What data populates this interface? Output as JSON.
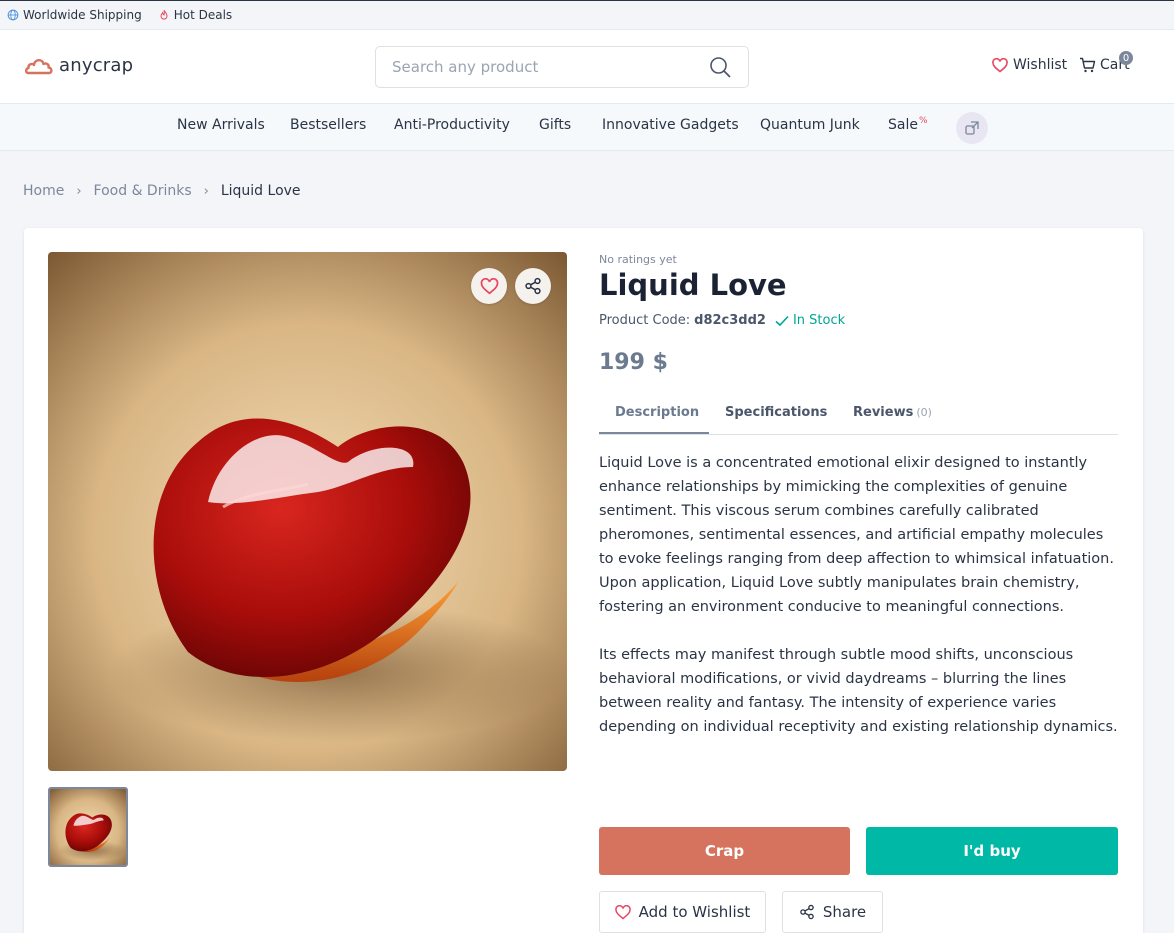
{
  "topbar": {
    "shipping_label": "Worldwide Shipping",
    "deals_label": "Hot Deals"
  },
  "header": {
    "logo_text": "anycrap",
    "search_placeholder": "Search any product",
    "wishlist_label": "Wishlist",
    "cart_label": "Cart",
    "cart_count": "0"
  },
  "nav": {
    "items": [
      "New Arrivals",
      "Bestsellers",
      "Anti-Productivity",
      "Gifts",
      "Innovative Gadgets",
      "Quantum Junk",
      "Sale"
    ],
    "sale_badge": "%"
  },
  "breadcrumb": {
    "home": "Home",
    "category": "Food & Drinks",
    "current": "Liquid Love"
  },
  "product": {
    "rating_text": "No ratings yet",
    "title": "Liquid Love",
    "code_label": "Product Code:",
    "code_value": "d82c3dd2",
    "stock_label": "In Stock",
    "price": "199 $",
    "tabs": {
      "description": "Description",
      "specifications": "Specifications",
      "reviews": "Reviews",
      "reviews_count": "(0)"
    },
    "description": [
      "Liquid Love is a concentrated emotional elixir designed to instantly enhance relationships by mimicking the complexities of genuine sentiment. This viscous serum combines carefully calibrated pheromones, sentimental essences, and artificial empathy molecules to evoke feelings ranging from deep affection to whimsical infatuation. Upon application, Liquid Love subtly manipulates brain chemistry, fostering an environment conducive to meaningful connections.",
      "Its effects may manifest through subtle mood shifts, unconscious behavioral modifications, or vivid daydreams – blurring the lines between reality and fantasy. The intensity of experience varies depending on individual receptivity and existing relationship dynamics."
    ],
    "actions": {
      "crap": "Crap",
      "buy": "I'd buy",
      "add_wishlist": "Add to Wishlist",
      "share": "Share"
    }
  },
  "colors": {
    "crap_button": "#d6735e",
    "buy_button": "#00b8a6",
    "in_stock": "#00a693",
    "logo": "#d6735e"
  },
  "icons": [
    "globe-icon",
    "fire-icon",
    "cloud-logo-icon",
    "search-icon",
    "heart-icon",
    "cart-icon",
    "share-icon",
    "check-icon",
    "chevron-right-icon",
    "link-icon"
  ]
}
